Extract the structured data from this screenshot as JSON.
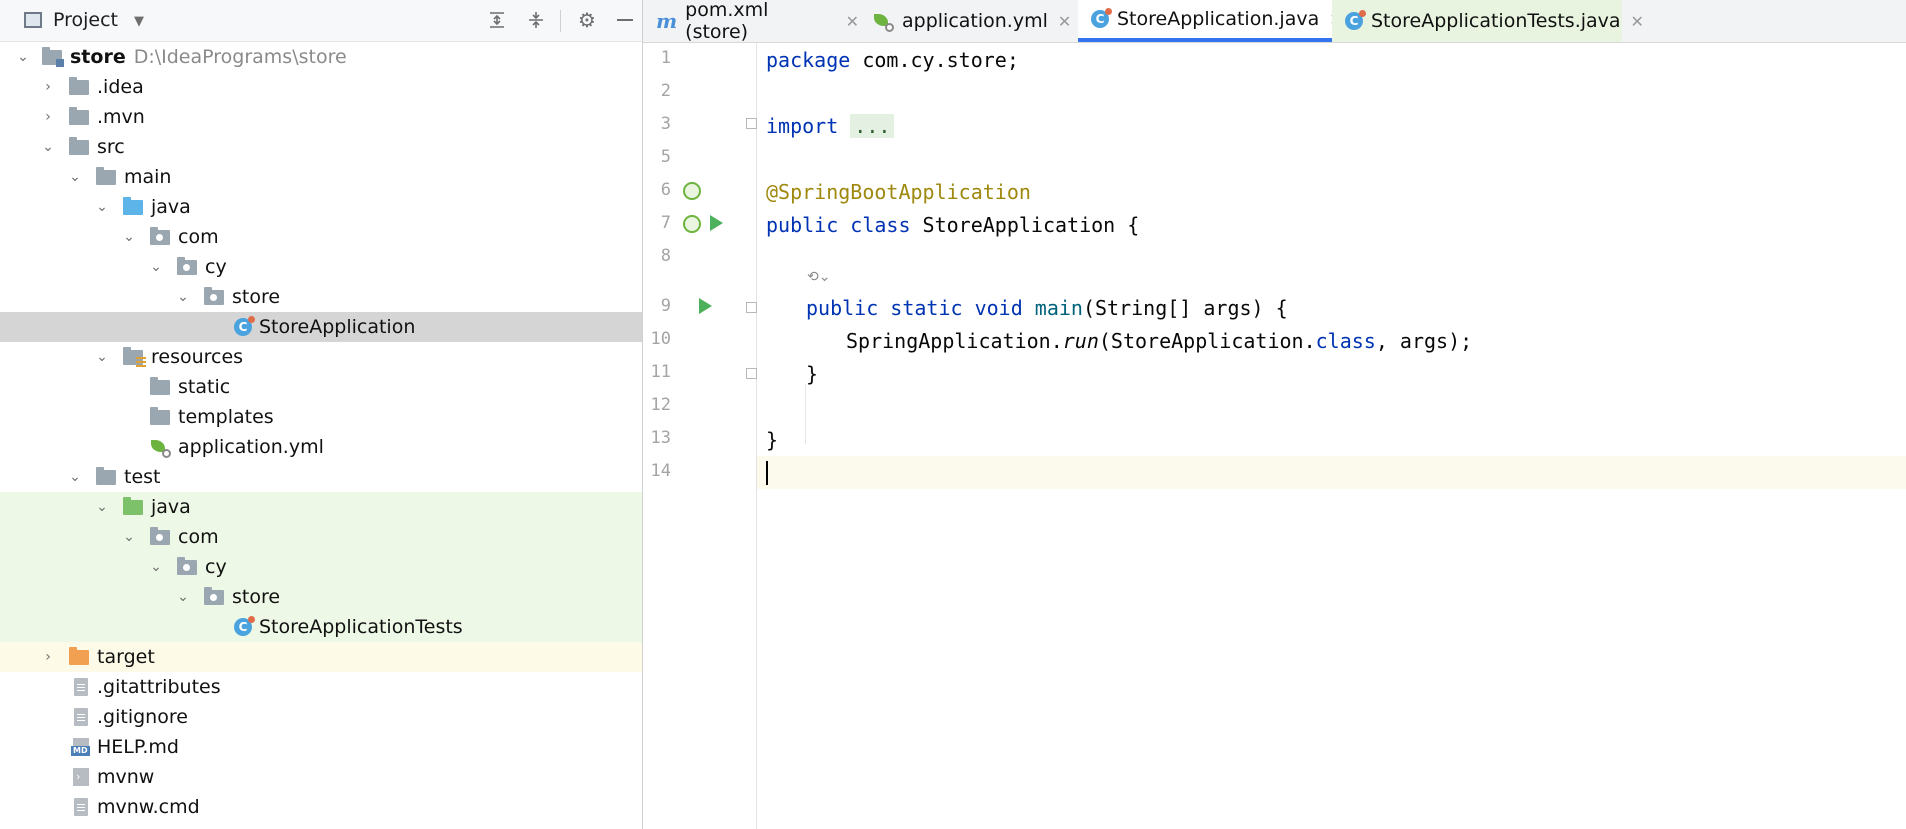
{
  "project_panel": {
    "title": "Project",
    "tree": [
      {
        "label": "store",
        "path": "D:\\IdeaPrograms\\store"
      },
      {
        "label": ".idea"
      },
      {
        "label": ".mvn"
      },
      {
        "label": "src"
      },
      {
        "label": "main"
      },
      {
        "label": "java"
      },
      {
        "label": "com"
      },
      {
        "label": "cy"
      },
      {
        "label": "store"
      },
      {
        "label": "StoreApplication"
      },
      {
        "label": "resources"
      },
      {
        "label": "static"
      },
      {
        "label": "templates"
      },
      {
        "label": "application.yml"
      },
      {
        "label": "test"
      },
      {
        "label": "java"
      },
      {
        "label": "com"
      },
      {
        "label": "cy"
      },
      {
        "label": "store"
      },
      {
        "label": "StoreApplicationTests"
      },
      {
        "label": "target"
      },
      {
        "label": ".gitattributes"
      },
      {
        "label": ".gitignore"
      },
      {
        "label": "HELP.md"
      },
      {
        "label": "mvnw"
      },
      {
        "label": "mvnw.cmd"
      }
    ]
  },
  "editor": {
    "tabs": [
      {
        "label": "pom.xml (store)",
        "icon": "m"
      },
      {
        "label": "application.yml"
      },
      {
        "label": "StoreApplication.java"
      },
      {
        "label": "StoreApplicationTests.java"
      }
    ],
    "line_numbers": [
      "1",
      "2",
      "3",
      "5",
      "6",
      "7",
      "8",
      "9",
      "10",
      "11",
      "12",
      "13",
      "14"
    ],
    "code": {
      "l1_kw": "package",
      "l1_rest": " com.cy.store;",
      "l3_kw": "import",
      "l3_fold": "...",
      "l6_ann": "@SpringBootApplication",
      "l7_kw": "public class",
      "l7_rest": " StoreApplication {",
      "l9_kw": "public static void",
      "l9_fn": "main",
      "l9_rest": "(String[] args) {",
      "l10_a": "SpringApplication.",
      "l10_run": "run",
      "l10_b": "(StoreApplication.",
      "l10_kw": "class",
      "l10_c": ", args);",
      "l11": "}",
      "l13": "}"
    }
  },
  "colors": {
    "keyword": "#0033b3",
    "annotation": "#9e880d",
    "method": "#00627a",
    "active_tab_underline": "#3574f0",
    "test_highlight": "#eef8e6",
    "selected_row": "#d5d5d5"
  }
}
